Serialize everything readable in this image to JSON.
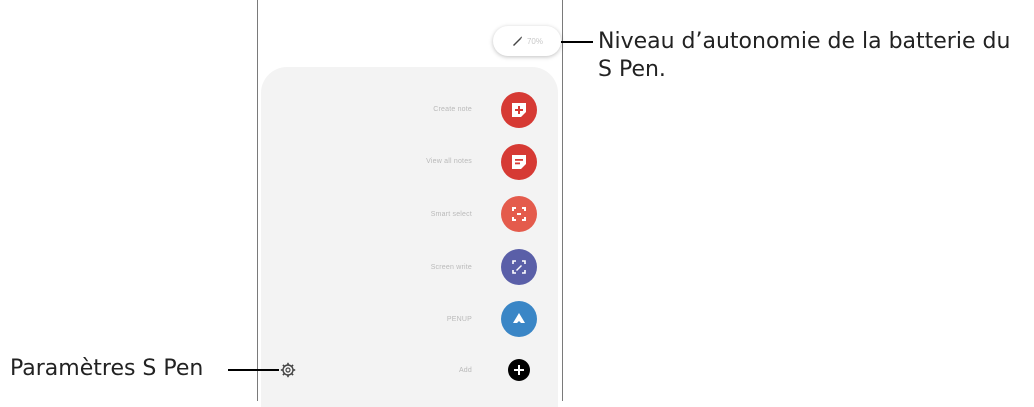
{
  "battery": {
    "percent_text": "70%"
  },
  "menu": {
    "items": [
      {
        "label": "Create note",
        "icon": "create-note-icon",
        "color": "#d63a34"
      },
      {
        "label": "View all notes",
        "icon": "view-all-notes-icon",
        "color": "#d63a34"
      },
      {
        "label": "Smart select",
        "icon": "smart-select-icon",
        "color": "#e45b4c"
      },
      {
        "label": "Screen write",
        "icon": "screen-write-icon",
        "color": "#5a5fa8"
      },
      {
        "label": "PENUP",
        "icon": "penup-icon",
        "color": "#3a86c6"
      },
      {
        "label": "Add",
        "icon": "add-icon",
        "color": "#000000"
      }
    ]
  },
  "callouts": {
    "battery_line1": "Niveau d’autonomie de la batterie du",
    "battery_line2": "S Pen.",
    "settings": "Paramètres S Pen"
  }
}
